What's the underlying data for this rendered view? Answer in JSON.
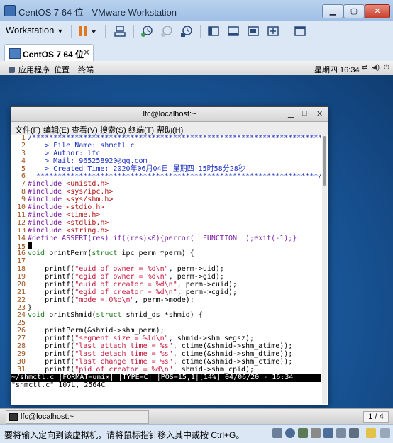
{
  "window": {
    "title": "CentOS 7 64 位 - VMware Workstation"
  },
  "toolbar": {
    "workstation_label": "Workstation"
  },
  "vm_tab": {
    "label": "CentOS 7 64 位"
  },
  "gnome_panel": {
    "applications": "应用程序",
    "places": "位置",
    "terminal": "终端",
    "clock": "星期四 16:34"
  },
  "terminal": {
    "title": "lfc@localhost:~",
    "menu": [
      "文件(F)",
      "编辑(E)",
      "查看(V)",
      "搜索(S)",
      "终端(T)",
      "帮助(H)"
    ],
    "lines": [
      {
        "no": "1",
        "text": "/*********************************************************************"
      },
      {
        "no": "2",
        "text": "    > File Name: shmctl.c"
      },
      {
        "no": "3",
        "text": "    > Author: lfc"
      },
      {
        "no": "4",
        "text": "    > Mail: 965258920@qq.com"
      },
      {
        "no": "5",
        "text": "    > Created Time: 2020年06月04日 星期四 15时58分28秒"
      },
      {
        "no": "6",
        "text": "  ******************************************************************/"
      },
      {
        "no": "7",
        "text": "#include <unistd.h>"
      },
      {
        "no": "8",
        "text": "#include <sys/ipc.h>"
      },
      {
        "no": "9",
        "text": "#include <sys/shm.h>"
      },
      {
        "no": "10",
        "text": "#include <stdio.h>"
      },
      {
        "no": "11",
        "text": "#include <time.h>"
      },
      {
        "no": "12",
        "text": "#include <stdlib.h>"
      },
      {
        "no": "13",
        "text": "#include <string.h>"
      },
      {
        "no": "14",
        "text": "#define ASSERT(res) if((res)<0){perror(__FUNCTION__);exit(-1);}"
      },
      {
        "no": "15",
        "text": ""
      },
      {
        "no": "16",
        "text": "void printPerm(struct ipc_perm *perm) {"
      },
      {
        "no": "17",
        "text": ""
      },
      {
        "no": "18",
        "text": "    printf(\"euid of owner = %d\\n\", perm->uid);"
      },
      {
        "no": "19",
        "text": "    printf(\"egid of owner = %d\\n\", perm->gid);"
      },
      {
        "no": "20",
        "text": "    printf(\"euid of creator = %d\\n\", perm->cuid);"
      },
      {
        "no": "21",
        "text": "    printf(\"egid of creator = %d\\n\", perm->cgid);"
      },
      {
        "no": "22",
        "text": "    printf(\"mode = 0%o\\n\", perm->mode);"
      },
      {
        "no": "23",
        "text": "}"
      },
      {
        "no": "24",
        "text": "void printShmid(struct shmid_ds *shmid) {"
      },
      {
        "no": "25",
        "text": ""
      },
      {
        "no": "26",
        "text": "    printPerm(&shmid->shm_perm);"
      },
      {
        "no": "27",
        "text": "    printf(\"segment size = %ld\\n\", shmid->shm_segsz);"
      },
      {
        "no": "28",
        "text": "    printf(\"last attach time = %s\", ctime(&shmid->shm_atime));"
      },
      {
        "no": "29",
        "text": "    printf(\"last detach time = %s\", ctime(&shmid->shm_dtime));"
      },
      {
        "no": "30",
        "text": "    printf(\"last change time = %s\", ctime(&shmid->shm_ctime));"
      },
      {
        "no": "31",
        "text": "    printf(\"pid of creator = %d\\n\", shmid->shm_cpid);"
      }
    ],
    "status_line": "~/shmctl.c |FORMAT=unix| |TYPE=C| |POS=15,1|[14%] 04/06/20 - 16:34",
    "message_line": "\"shmctl.c\" 107L, 2564C"
  },
  "taskbar": {
    "item_label": "lfc@localhost:~",
    "workspace": "1 / 4"
  },
  "status_bar": {
    "hint": "要将输入定向到该虚拟机，请将鼠标指针移入其中或按 Ctrl+G。"
  }
}
